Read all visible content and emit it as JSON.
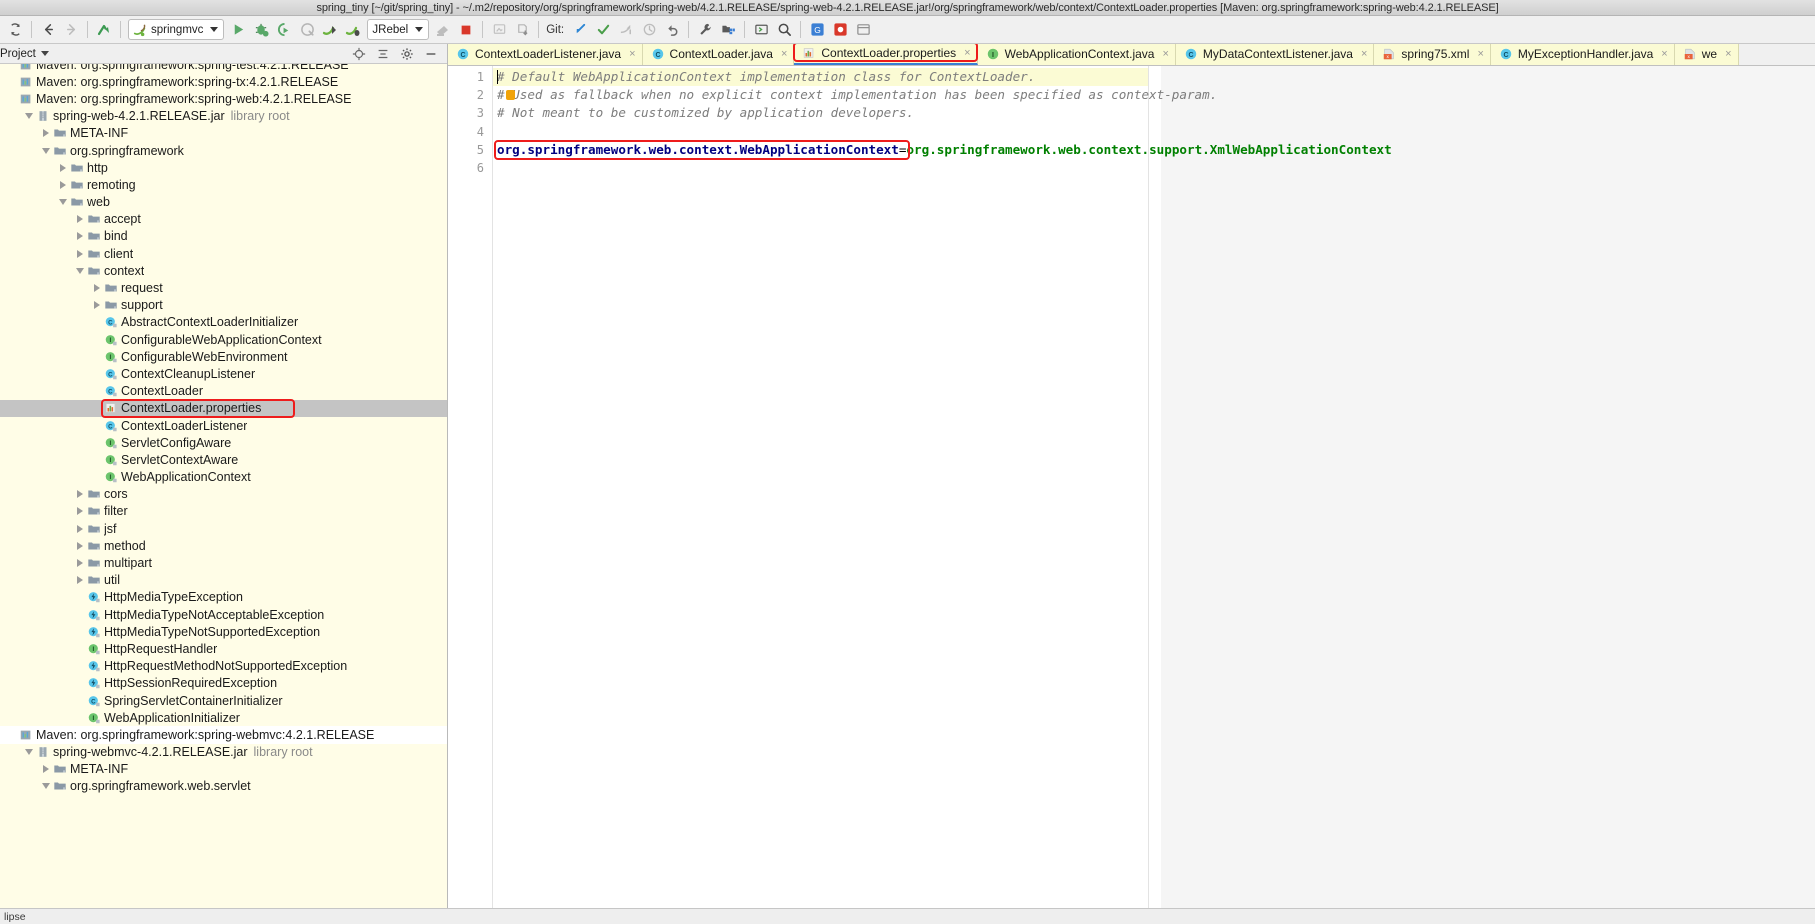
{
  "window": {
    "title": "spring_tiny [~/git/spring_tiny] - ~/.m2/repository/org/springframework/spring-web/4.2.1.RELEASE/spring-web-4.2.1.RELEASE.jar!/org/springframework/web/context/ContextLoader.properties [Maven: org.springframework:spring-web:4.2.1.RELEASE]"
  },
  "toolbar": {
    "run_config": "springmvc",
    "jrebel": "JRebel",
    "git_label": "Git:",
    "icons": [
      "sync-icon",
      "back-arrow-icon",
      "forward-arrow-icon",
      "jump-to-source-icon",
      "run-icon",
      "debug-icon",
      "run-with-coverage-icon",
      "profile-icon",
      "jrebel-run-icon",
      "jrebel-debug-icon",
      "build-icon",
      "stop-icon",
      "build-module-icon",
      "update-icon",
      "git-update-icon",
      "git-commit-icon",
      "git-push-icon",
      "git-history-icon",
      "git-rollback-icon",
      "settings-wrench-icon",
      "project-structure-icon",
      "terminal-icon",
      "search-everywhere-icon",
      "google-search-icon",
      "bug-report-icon",
      "other-icon"
    ]
  },
  "project_panel": {
    "title": "Project",
    "header_icons": [
      "locate-icon",
      "collapse-all-icon",
      "settings-gear-icon",
      "hide-icon"
    ],
    "tree": [
      {
        "indent": 0,
        "arrow": "none",
        "icon": "maven-lib-icon",
        "label": "Maven: org.springframework:spring-test:4.2.1.RELEASE",
        "clipped": true
      },
      {
        "indent": 0,
        "arrow": "none",
        "icon": "maven-lib-icon",
        "label": "Maven: org.springframework:spring-tx:4.2.1.RELEASE"
      },
      {
        "indent": 0,
        "arrow": "none",
        "icon": "maven-lib-icon",
        "label": "Maven: org.springframework:spring-web:4.2.1.RELEASE"
      },
      {
        "indent": 1,
        "arrow": "expanded",
        "icon": "jar-icon",
        "label": "spring-web-4.2.1.RELEASE.jar",
        "sublabel": "library root"
      },
      {
        "indent": 2,
        "arrow": "collapsed",
        "icon": "folder-icon",
        "label": "META-INF"
      },
      {
        "indent": 2,
        "arrow": "expanded",
        "icon": "folder-icon",
        "label": "org.springframework"
      },
      {
        "indent": 3,
        "arrow": "collapsed",
        "icon": "folder-icon",
        "label": "http"
      },
      {
        "indent": 3,
        "arrow": "collapsed",
        "icon": "folder-icon",
        "label": "remoting"
      },
      {
        "indent": 3,
        "arrow": "expanded",
        "icon": "folder-icon",
        "label": "web"
      },
      {
        "indent": 4,
        "arrow": "collapsed",
        "icon": "folder-icon",
        "label": "accept"
      },
      {
        "indent": 4,
        "arrow": "collapsed",
        "icon": "folder-icon",
        "label": "bind"
      },
      {
        "indent": 4,
        "arrow": "collapsed",
        "icon": "folder-icon",
        "label": "client"
      },
      {
        "indent": 4,
        "arrow": "expanded",
        "icon": "folder-icon",
        "label": "context"
      },
      {
        "indent": 5,
        "arrow": "collapsed",
        "icon": "folder-icon",
        "label": "request"
      },
      {
        "indent": 5,
        "arrow": "collapsed",
        "icon": "folder-icon",
        "label": "support"
      },
      {
        "indent": 5,
        "arrow": "none",
        "icon": "class-icon",
        "label": "AbstractContextLoaderInitializer"
      },
      {
        "indent": 5,
        "arrow": "none",
        "icon": "interface-icon",
        "label": "ConfigurableWebApplicationContext"
      },
      {
        "indent": 5,
        "arrow": "none",
        "icon": "interface-icon",
        "label": "ConfigurableWebEnvironment"
      },
      {
        "indent": 5,
        "arrow": "none",
        "icon": "class-icon",
        "label": "ContextCleanupListener"
      },
      {
        "indent": 5,
        "arrow": "none",
        "icon": "class-icon",
        "label": "ContextLoader"
      },
      {
        "indent": 5,
        "arrow": "none",
        "icon": "properties-icon",
        "label": "ContextLoader.properties",
        "selected": true,
        "highlighted": true
      },
      {
        "indent": 5,
        "arrow": "none",
        "icon": "class-icon",
        "label": "ContextLoaderListener"
      },
      {
        "indent": 5,
        "arrow": "none",
        "icon": "interface-icon",
        "label": "ServletConfigAware"
      },
      {
        "indent": 5,
        "arrow": "none",
        "icon": "interface-icon",
        "label": "ServletContextAware"
      },
      {
        "indent": 5,
        "arrow": "none",
        "icon": "interface-icon",
        "label": "WebApplicationContext"
      },
      {
        "indent": 4,
        "arrow": "collapsed",
        "icon": "folder-icon",
        "label": "cors"
      },
      {
        "indent": 4,
        "arrow": "collapsed",
        "icon": "folder-icon",
        "label": "filter"
      },
      {
        "indent": 4,
        "arrow": "collapsed",
        "icon": "folder-icon",
        "label": "jsf"
      },
      {
        "indent": 4,
        "arrow": "collapsed",
        "icon": "folder-icon",
        "label": "method"
      },
      {
        "indent": 4,
        "arrow": "collapsed",
        "icon": "folder-icon",
        "label": "multipart"
      },
      {
        "indent": 4,
        "arrow": "collapsed",
        "icon": "folder-icon",
        "label": "util"
      },
      {
        "indent": 4,
        "arrow": "none",
        "icon": "exception-icon",
        "label": "HttpMediaTypeException"
      },
      {
        "indent": 4,
        "arrow": "none",
        "icon": "exception-icon",
        "label": "HttpMediaTypeNotAcceptableException"
      },
      {
        "indent": 4,
        "arrow": "none",
        "icon": "exception-icon",
        "label": "HttpMediaTypeNotSupportedException"
      },
      {
        "indent": 4,
        "arrow": "none",
        "icon": "interface-icon",
        "label": "HttpRequestHandler"
      },
      {
        "indent": 4,
        "arrow": "none",
        "icon": "exception-icon",
        "label": "HttpRequestMethodNotSupportedException"
      },
      {
        "indent": 4,
        "arrow": "none",
        "icon": "exception-icon",
        "label": "HttpSessionRequiredException"
      },
      {
        "indent": 4,
        "arrow": "none",
        "icon": "class-icon",
        "label": "SpringServletContainerInitializer"
      },
      {
        "indent": 4,
        "arrow": "none",
        "icon": "interface-icon",
        "label": "WebApplicationInitializer"
      },
      {
        "indent": 0,
        "arrow": "none",
        "icon": "maven-lib-icon",
        "label": "Maven: org.springframework:spring-webmvc:4.2.1.RELEASE",
        "white": true
      },
      {
        "indent": 1,
        "arrow": "expanded",
        "icon": "jar-icon",
        "label": "spring-webmvc-4.2.1.RELEASE.jar",
        "sublabel": "library root"
      },
      {
        "indent": 2,
        "arrow": "collapsed",
        "icon": "folder-icon",
        "label": "META-INF"
      },
      {
        "indent": 2,
        "arrow": "expanded",
        "icon": "folder-icon",
        "label": "org.springframework.web.servlet",
        "clipped": true
      }
    ]
  },
  "editor": {
    "tabs": [
      {
        "icon": "java-class-icon",
        "label": "ContextLoaderListener.java",
        "close": "×"
      },
      {
        "icon": "java-class-icon",
        "label": "ContextLoader.java",
        "close": "×"
      },
      {
        "icon": "properties-icon",
        "label": "ContextLoader.properties",
        "close": "×",
        "active": true,
        "highlighted": true
      },
      {
        "icon": "java-interface-icon",
        "label": "WebApplicationContext.java",
        "close": "×"
      },
      {
        "icon": "java-class-icon",
        "label": "MyDataContextListener.java",
        "close": "×"
      },
      {
        "icon": "xml-icon",
        "label": "spring75.xml",
        "close": "×"
      },
      {
        "icon": "java-class-icon",
        "label": "MyExceptionHandler.java",
        "close": "×"
      },
      {
        "icon": "xml-icon",
        "label": "we",
        "close": "×"
      }
    ],
    "line_numbers": [
      "1",
      "2",
      "3",
      "4",
      "5",
      "6"
    ],
    "lines": [
      {
        "type": "comment",
        "text": "# Default WebApplicationContext implementation class for ContextLoader.",
        "current": true
      },
      {
        "type": "comment",
        "text": "# Used as fallback when no explicit context implementation has been specified as context-param."
      },
      {
        "type": "comment",
        "text": "# Not meant to be customized by application developers."
      },
      {
        "type": "blank",
        "text": ""
      },
      {
        "type": "property",
        "key": "org.springframework.web.context.WebApplicationContext",
        "sep": "=",
        "value": "org.springframework.web.context.support.XmlWebApplicationContext",
        "highlighted": true
      },
      {
        "type": "blank",
        "text": ""
      }
    ]
  },
  "statusbar": {
    "text": "lipse"
  },
  "colors": {
    "highlight_red": "#ee1c1c",
    "selection_gray": "#c4c4c4",
    "tab_bg": "#fbfbd4",
    "tree_bg": "#fffde7",
    "key_blue": "#000080",
    "value_green": "#008000",
    "comment_gray": "#7d7d7d"
  }
}
